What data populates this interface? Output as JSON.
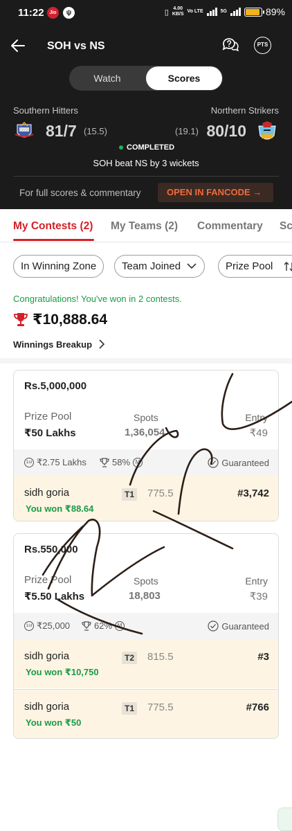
{
  "status_bar": {
    "time": "11:22",
    "carrier_badge": "Jio",
    "app_badge": "ψ",
    "speed_value": "4.00",
    "speed_unit": "KB/S",
    "volte": "Vo LTE",
    "network": "5G",
    "battery_percent": "89%",
    "battery_level": 0.89,
    "battery_color": "#f3b21a"
  },
  "header": {
    "title": "SOH vs NS",
    "pts_label": "PTS",
    "toggle": {
      "watch": "Watch",
      "scores": "Scores",
      "selected": "Scores"
    }
  },
  "score": {
    "team1": {
      "name": "Southern Hitters",
      "score": "81/7",
      "overs": "(15.5)"
    },
    "team2": {
      "name": "Northern Strikers",
      "score": "80/10",
      "overs": "(19.1)"
    },
    "status": "COMPLETED",
    "status_color": "#1fb45a",
    "result": "SOH beat NS by 3 wickets",
    "fancode_note": "For full scores & commentary",
    "fancode_button": "OPEN IN FANCODE →"
  },
  "tabs": [
    {
      "label": "My Contests (2)",
      "active": true
    },
    {
      "label": "My Teams (2)",
      "active": false
    },
    {
      "label": "Commentary",
      "active": false
    },
    {
      "label": "Sc",
      "active": false
    }
  ],
  "filters": [
    {
      "label": "In Winning Zone"
    },
    {
      "label": "Team Joined",
      "icon": "chevron-down-icon"
    },
    {
      "label": "Prize Pool",
      "icon": "sort-icon"
    }
  ],
  "summary": {
    "congrats": "Congratulations! You've won in 2 contests.",
    "winnings": "₹10,888.64",
    "breakup_label": "Winnings Breakup"
  },
  "labels": {
    "prize_pool": "Prize Pool",
    "spots": "Spots",
    "entry": "Entry",
    "guaranteed": "Guaranteed",
    "m_badge": "M",
    "first_badge": "1st"
  },
  "contests": [
    {
      "title": "Rs.5,000,000",
      "prize_pool": "₹50 Lakhs",
      "spots": "1,36,054",
      "entry": "₹49",
      "first_prize": "₹2.75 Lakhs",
      "win_percent": "58%",
      "entries": [
        {
          "user": "sidh goria",
          "team": "T1",
          "points": "775.5",
          "rank": "#3,742",
          "won": "You won ₹88.64"
        }
      ]
    },
    {
      "title": "Rs.550,000",
      "prize_pool": "₹5.50 Lakhs",
      "spots": "18,803",
      "entry": "₹39",
      "first_prize": "₹25,000",
      "win_percent": "62%",
      "entries": [
        {
          "user": "sidh goria",
          "team": "T2",
          "points": "815.5",
          "rank": "#3",
          "won": "You won ₹10,750"
        },
        {
          "user": "sidh goria",
          "team": "T1",
          "points": "775.5",
          "rank": "#766",
          "won": "You won ₹50"
        }
      ]
    }
  ],
  "theme": {
    "accent": "#d32027",
    "header_bg": "#1b1b1b",
    "win_green": "#1a9a46",
    "fancode_orange": "#f26a3a"
  }
}
